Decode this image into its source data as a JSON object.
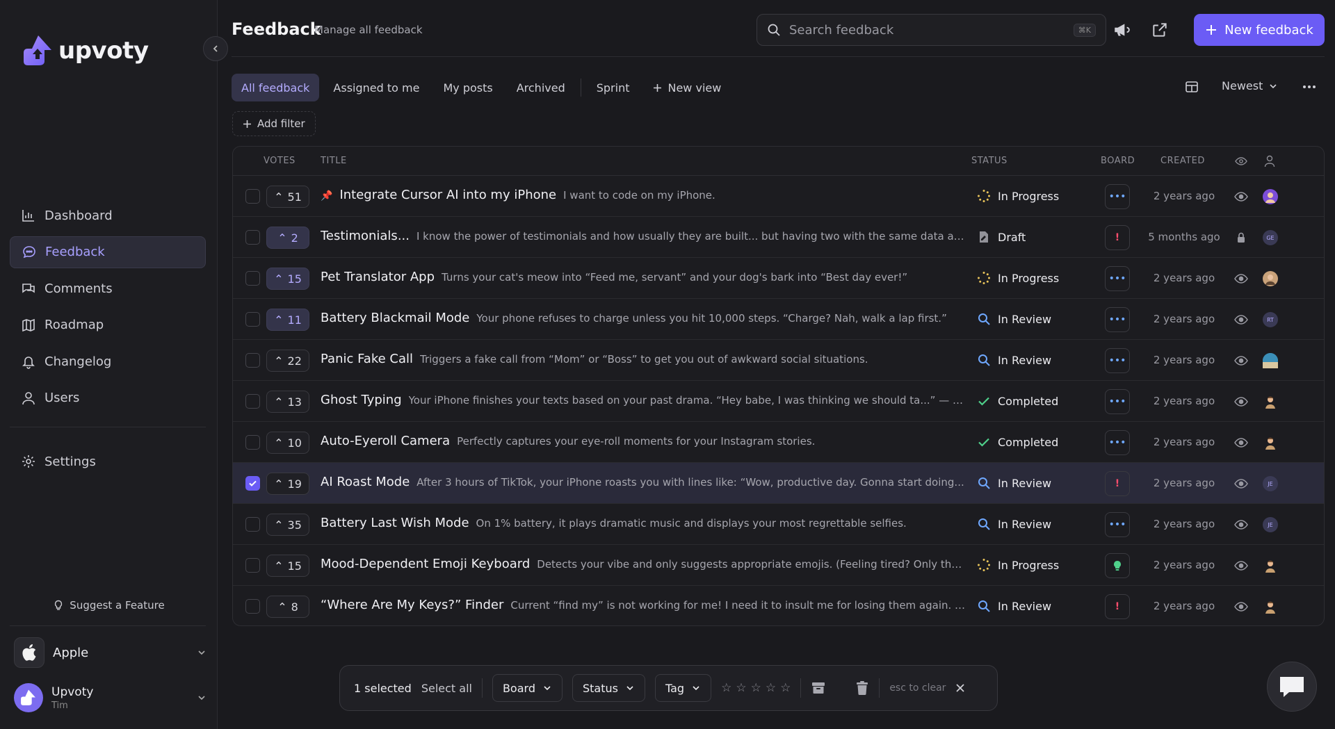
{
  "brand": {
    "name": "upvoty"
  },
  "sidebar": {
    "items": [
      {
        "label": "Dashboard",
        "icon": "chart-icon"
      },
      {
        "label": "Feedback",
        "icon": "chat-bubble-icon"
      },
      {
        "label": "Comments",
        "icon": "comments-icon"
      },
      {
        "label": "Roadmap",
        "icon": "map-icon"
      },
      {
        "label": "Changelog",
        "icon": "bell-icon"
      },
      {
        "label": "Users",
        "icon": "user-icon"
      }
    ],
    "settings_label": "Settings",
    "suggest_label": "Suggest a Feature",
    "workspace": "Apple",
    "user": {
      "name": "Upvoty",
      "sub": "Tim"
    }
  },
  "header": {
    "title": "Feedback",
    "subtitle": "Manage all feedback",
    "search_placeholder": "Search feedback",
    "shortcut": "⌘K",
    "new_button": "New feedback"
  },
  "tabs": {
    "all": "All feedback",
    "assigned": "Assigned to me",
    "posts": "My posts",
    "archived": "Archived",
    "sprint": "Sprint",
    "new_view": "New view",
    "sort": "Newest",
    "add_filter": "Add filter"
  },
  "table": {
    "columns": {
      "votes": "VOTES",
      "title": "TITLE",
      "status": "STATUS",
      "board": "BOARD",
      "created": "CREATED"
    },
    "rows": [
      {
        "votes": "51",
        "pinned": true,
        "title": "Integrate Cursor AI into my iPhone",
        "desc": "I want to code on my iPhone.",
        "status": "In Progress",
        "created": "2 years ago"
      },
      {
        "votes": "2",
        "title": "Testimonials...",
        "desc": "I know the power of testimonials and how usually they are built... but having two with the same data and one...",
        "status": "Draft",
        "created": "5 months ago",
        "avatar": "GE"
      },
      {
        "votes": "15",
        "title": "Pet Translator App",
        "desc": "Turns your cat's meow into “Feed me, servant” and your dog's bark into “Best day ever!”",
        "status": "In Progress",
        "created": "2 years ago"
      },
      {
        "votes": "11",
        "title": "Battery Blackmail Mode",
        "desc": "Your phone refuses to charge unless you hit 10,000 steps. “Charge? Nah, walk a lap first.”",
        "status": "In Review",
        "created": "2 years ago",
        "avatar": "RT"
      },
      {
        "votes": "22",
        "title": "Panic Fake Call",
        "desc": "Triggers a fake call from “Mom” or “Boss” to get you out of awkward social situations.",
        "status": "In Review",
        "created": "2 years ago"
      },
      {
        "votes": "13",
        "title": "Ghost Typing",
        "desc": "Your iPhone finishes your texts based on your past drama. “Hey babe, I was thinking we should ta...” — “...take a...",
        "status": "Completed",
        "created": "2 years ago"
      },
      {
        "votes": "10",
        "title": "Auto-Eyeroll Camera",
        "desc": "Perfectly captures your eye-roll moments for your Instagram stories.",
        "status": "Completed",
        "created": "2 years ago"
      },
      {
        "votes": "19",
        "title": "AI Roast Mode",
        "desc": "After 3 hours of TikTok, your iPhone roasts you with lines like: “Wow, productive day. Gonna start doing...",
        "status": "In Review",
        "created": "2 years ago",
        "avatar": "JE"
      },
      {
        "votes": "35",
        "title": "Battery Last Wish Mode",
        "desc": "On 1% battery, it plays dramatic music and displays your most regrettable selfies.",
        "status": "In Review",
        "created": "2 years ago",
        "avatar": "JE"
      },
      {
        "votes": "15",
        "title": "Mood-Dependent Emoji Keyboard",
        "desc": "Detects your vibe and only suggests appropriate emojis. (Feeling tired? Only the 🥱🥱...",
        "status": "In Progress",
        "created": "2 years ago"
      },
      {
        "votes": "8",
        "title": "“Where Are My Keys?” Finder",
        "desc": "Current “find my” is not working for me! I need it to insult me for losing them again. “Oh,...",
        "status": "In Review",
        "created": "2 years ago"
      }
    ]
  },
  "bulk": {
    "selected": "1 selected",
    "select_all": "Select all",
    "board": "Board",
    "status": "Status",
    "tag": "Tag",
    "hint": "esc to clear"
  },
  "colors": {
    "accent": "#6b5cf5",
    "bg": "#1a1a1e",
    "progress": "#e8c35a",
    "review": "#6fa8ff",
    "completed": "#4fd18b",
    "alert": "#ff4d6d"
  }
}
